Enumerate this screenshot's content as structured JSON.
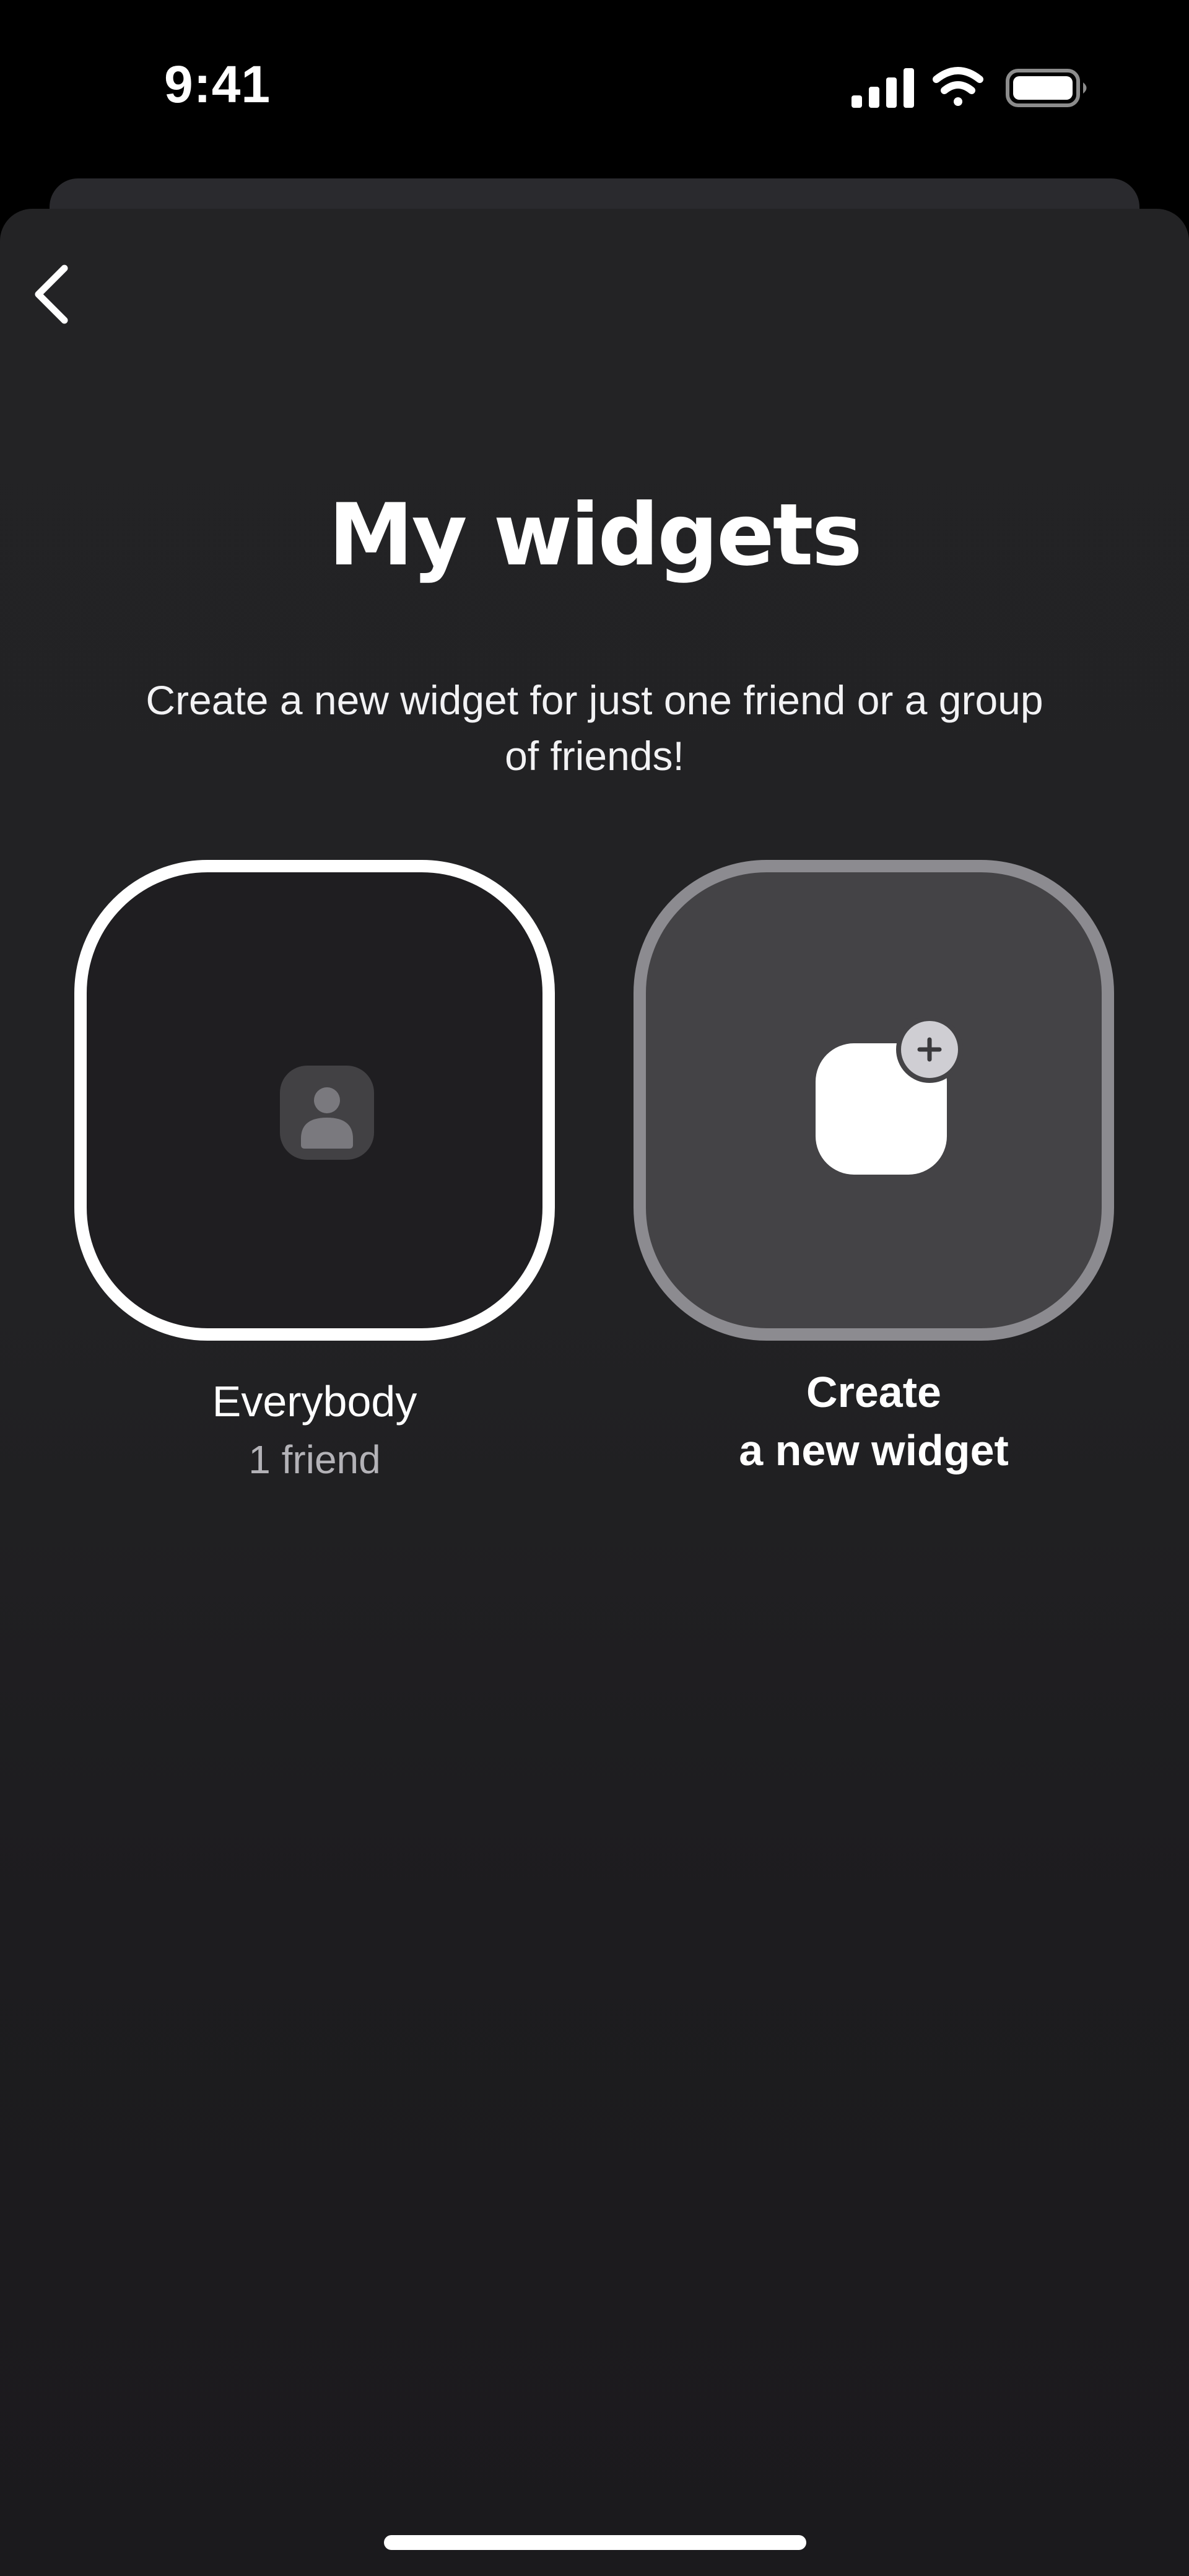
{
  "status_bar": {
    "time": "9:41",
    "icons": [
      "cellular-signal-icon",
      "wifi-icon",
      "battery-icon"
    ]
  },
  "nav": {
    "back_icon": "chevron-left-icon"
  },
  "header": {
    "title": "My widgets",
    "subtitle": "Create a new widget for just one friend or a group of friends!"
  },
  "widgets": [
    {
      "label": "Everybody",
      "sublabel": "1 friend",
      "icon": "person-icon",
      "selected": true
    },
    {
      "label_line1": "Create",
      "label_line2": "a new widget",
      "icon": "add-widget-icon"
    }
  ],
  "colors": {
    "background": "#222224",
    "selected_border": "#ffffff",
    "create_tile": "#444346",
    "create_border": "#8c8b90",
    "secondary_text": "#b3b2b7"
  }
}
